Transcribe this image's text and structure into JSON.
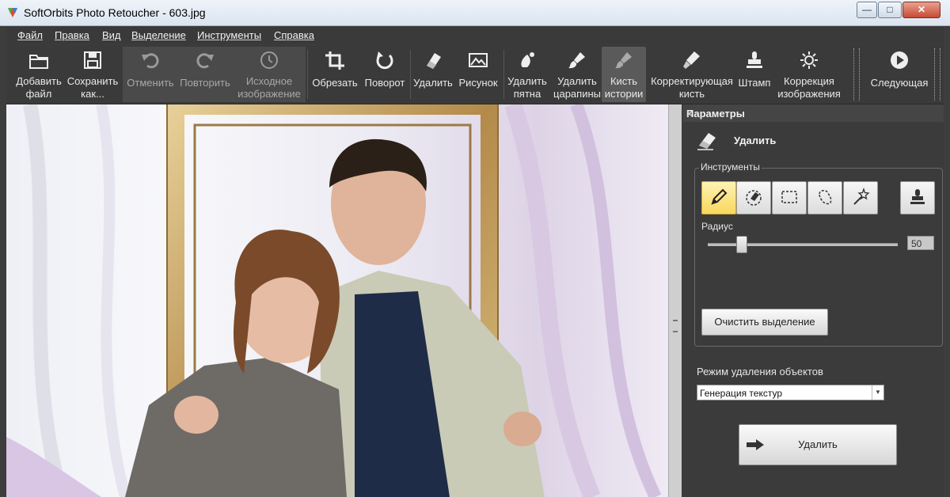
{
  "window": {
    "title": "SoftOrbits Photo Retoucher - 603.jpg",
    "minimize": "—",
    "maximize": "□",
    "close": "✕"
  },
  "menu": [
    "Файл",
    "Правка",
    "Вид",
    "Выделение",
    "Инструменты",
    "Справка"
  ],
  "toolbar": {
    "add": [
      "Добавить",
      "файл"
    ],
    "save": [
      "Сохранить",
      "как..."
    ],
    "undo": "Отменить",
    "redo": "Повторить",
    "original": [
      "Исходное",
      "изображение"
    ],
    "crop": "Обрезать",
    "rotate": "Поворот",
    "erase": "Удалить",
    "drawing": "Рисунок",
    "spots": [
      "Удалить",
      "пятна"
    ],
    "scratches": [
      "Удалить",
      "царапины"
    ],
    "history_brush": [
      "Кисть",
      "истории"
    ],
    "correcting_brush": [
      "Корректирующая",
      "кисть"
    ],
    "stamp": "Штамп",
    "correction": [
      "Коррекция",
      "изображения"
    ],
    "next": "Следующая"
  },
  "panel": {
    "header": "Параметры",
    "close": "×",
    "tool_name": "Удалить",
    "tools_group": "Инструменты",
    "radius_label": "Радиус",
    "radius_value": "50",
    "radius_fraction": 0.18,
    "clear_selection": "Очистить выделение",
    "removal_mode_label": "Режим удаления объектов",
    "removal_mode_value": "Генерация текстур",
    "remove_button": "Удалить"
  }
}
